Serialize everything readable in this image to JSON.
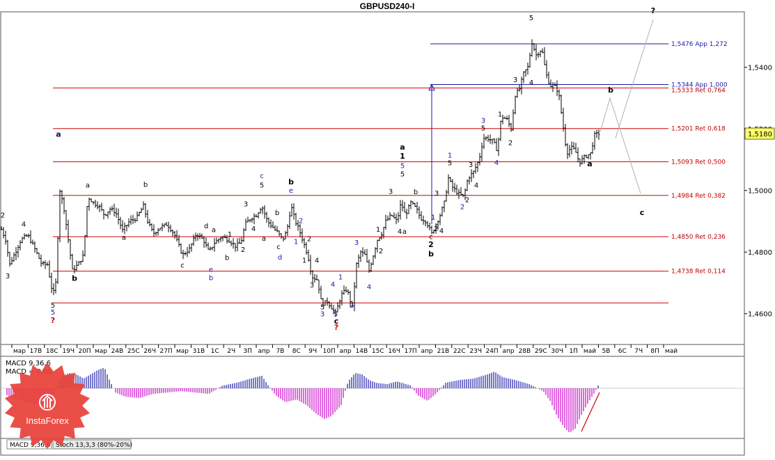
{
  "title": "GBPUSD240-I",
  "current_price": "1,5180",
  "colors": {
    "ret_line": "#d00000",
    "app_line": "#1a1aa8",
    "candle": "#000000",
    "macd_hist": "#cc00cc",
    "macd_hist_pos": "#1a1aa8",
    "projection": "#b0b0b0",
    "logo": "#e8423a"
  },
  "chart_data": {
    "type": "candlestick",
    "symbol": "GBPUSD",
    "timeframe": "H4",
    "ylim": [
      1.45,
      1.558
    ],
    "y_ticks": [
      "1,5400",
      "1,5200",
      "1,5000",
      "1,4800",
      "1,4600"
    ],
    "y_tick_values": [
      1.54,
      1.52,
      1.5,
      1.48,
      1.46
    ],
    "x_ticks": [
      "мар",
      "17В",
      "18С",
      "19Ч",
      "20П",
      "мар",
      "24В",
      "25С",
      "26Ч",
      "27П",
      "мар",
      "31В",
      "1С",
      "2Ч",
      "3П",
      "апр",
      "7В",
      "8С",
      "9Ч",
      "10П",
      "апр",
      "14В",
      "15С",
      "16Ч",
      "17П",
      "апр",
      "21В",
      "22С",
      "23Ч",
      "24П",
      "апр",
      "28В",
      "29С",
      "30Ч",
      "1П",
      "май",
      "5В",
      "6С",
      "7Ч",
      "8П",
      "май"
    ],
    "levels": [
      {
        "label": "1,5476 App 1,272",
        "value": 1.5476,
        "kind": "app"
      },
      {
        "label": "1,5344 App 1,000",
        "value": 1.5344,
        "kind": "app"
      },
      {
        "label": "1,5333 Ret 0,764",
        "value": 1.5333,
        "kind": "ret"
      },
      {
        "label": "1,5201 Ret 0,618",
        "value": 1.5201,
        "kind": "ret"
      },
      {
        "label": "1,5093 Ret 0,500",
        "value": 1.5093,
        "kind": "ret"
      },
      {
        "label": "1,4984 Ret 0,382",
        "value": 1.4984,
        "kind": "ret"
      },
      {
        "label": "1,4850 Ret 0,236",
        "value": 1.485,
        "kind": "ret"
      },
      {
        "label": "1,4738 Ret 0,114",
        "value": 1.4738,
        "kind": "ret"
      },
      {
        "label": "",
        "value": 1.4635,
        "kind": "ret"
      }
    ],
    "path": [
      [
        0,
        1.4885
      ],
      [
        8,
        1.484
      ],
      [
        14,
        1.476
      ],
      [
        22,
        1.48
      ],
      [
        30,
        1.484
      ],
      [
        40,
        1.4855
      ],
      [
        50,
        1.481
      ],
      [
        60,
        1.476
      ],
      [
        68,
        1.476
      ],
      [
        76,
        1.466
      ],
      [
        80,
        1.47
      ],
      [
        86,
        1.5
      ],
      [
        92,
        1.494
      ],
      [
        98,
        1.484
      ],
      [
        104,
        1.474
      ],
      [
        112,
        1.476
      ],
      [
        120,
        1.479
      ],
      [
        126,
        1.498
      ],
      [
        134,
        1.496
      ],
      [
        142,
        1.495
      ],
      [
        150,
        1.492
      ],
      [
        158,
        1.494
      ],
      [
        166,
        1.493
      ],
      [
        176,
        1.487
      ],
      [
        186,
        1.49
      ],
      [
        196,
        1.491
      ],
      [
        206,
        1.495
      ],
      [
        212,
        1.49
      ],
      [
        220,
        1.486
      ],
      [
        230,
        1.488
      ],
      [
        240,
        1.489
      ],
      [
        250,
        1.486
      ],
      [
        262,
        1.479
      ],
      [
        272,
        1.481
      ],
      [
        282,
        1.486
      ],
      [
        292,
        1.484
      ],
      [
        300,
        1.48
      ],
      [
        308,
        1.483
      ],
      [
        318,
        1.485
      ],
      [
        328,
        1.484
      ],
      [
        338,
        1.482
      ],
      [
        346,
        1.483
      ],
      [
        352,
        1.489
      ],
      [
        360,
        1.491
      ],
      [
        368,
        1.492
      ],
      [
        376,
        1.495
      ],
      [
        384,
        1.49
      ],
      [
        392,
        1.488
      ],
      [
        400,
        1.486
      ],
      [
        406,
        1.484
      ],
      [
        412,
        1.487
      ],
      [
        418,
        1.495
      ],
      [
        424,
        1.49
      ],
      [
        430,
        1.487
      ],
      [
        436,
        1.483
      ],
      [
        442,
        1.479
      ],
      [
        448,
        1.472
      ],
      [
        456,
        1.471
      ],
      [
        462,
        1.463
      ],
      [
        470,
        1.464
      ],
      [
        476,
        1.462
      ],
      [
        482,
        1.46
      ],
      [
        490,
        1.466
      ],
      [
        498,
        1.468
      ],
      [
        506,
        1.462
      ],
      [
        512,
        1.476
      ],
      [
        518,
        1.48
      ],
      [
        524,
        1.479
      ],
      [
        530,
        1.474
      ],
      [
        536,
        1.479
      ],
      [
        542,
        1.484
      ],
      [
        548,
        1.486
      ],
      [
        554,
        1.49
      ],
      [
        562,
        1.492
      ],
      [
        570,
        1.49
      ],
      [
        576,
        1.496
      ],
      [
        582,
        1.492
      ],
      [
        590,
        1.496
      ],
      [
        598,
        1.494
      ],
      [
        604,
        1.491
      ],
      [
        612,
        1.49
      ],
      [
        620,
        1.486
      ],
      [
        626,
        1.489
      ],
      [
        632,
        1.492
      ],
      [
        638,
        1.496
      ],
      [
        644,
        1.504
      ],
      [
        650,
        1.501
      ],
      [
        658,
        1.499
      ],
      [
        666,
        1.498
      ],
      [
        672,
        1.504
      ],
      [
        680,
        1.506
      ],
      [
        688,
        1.51
      ],
      [
        694,
        1.517
      ],
      [
        700,
        1.517
      ],
      [
        708,
        1.516
      ],
      [
        714,
        1.513
      ],
      [
        720,
        1.524
      ],
      [
        728,
        1.523
      ],
      [
        734,
        1.52
      ],
      [
        740,
        1.531
      ],
      [
        746,
        1.533
      ],
      [
        752,
        1.538
      ],
      [
        758,
        1.54
      ],
      [
        764,
        1.548
      ],
      [
        770,
        1.544
      ],
      [
        778,
        1.546
      ],
      [
        784,
        1.538
      ],
      [
        790,
        1.534
      ],
      [
        796,
        1.534
      ],
      [
        802,
        1.532
      ],
      [
        808,
        1.522
      ],
      [
        814,
        1.512
      ],
      [
        820,
        1.514
      ],
      [
        826,
        1.513
      ],
      [
        832,
        1.509
      ],
      [
        840,
        1.511
      ],
      [
        848,
        1.512
      ],
      [
        854,
        1.518
      ],
      [
        860,
        1.5185
      ]
    ],
    "wave_labels": [
      {
        "t": "2",
        "x": 4,
        "p": 1.4912,
        "c": "k"
      },
      {
        "t": "4",
        "x": 34,
        "p": 1.4883,
        "c": "k"
      },
      {
        "t": "3",
        "x": 11,
        "p": 1.4715,
        "c": "k"
      },
      {
        "t": "a",
        "x": 84,
        "p": 1.5175,
        "c": "n",
        "b": true
      },
      {
        "t": "5",
        "x": 76,
        "p": 1.462,
        "c": "k"
      },
      {
        "t": "5",
        "x": 76,
        "p": 1.4597,
        "c": "b"
      },
      {
        "t": "?",
        "x": 76,
        "p": 1.457,
        "c": "r",
        "b": true
      },
      {
        "t": "b",
        "x": 107,
        "p": 1.4707,
        "c": "k",
        "b": true
      },
      {
        "t": "a",
        "x": 126,
        "p": 1.5009,
        "c": "k"
      },
      {
        "t": "a",
        "x": 178,
        "p": 1.484,
        "c": "k"
      },
      {
        "t": "b",
        "x": 209,
        "p": 1.5012,
        "c": "k"
      },
      {
        "t": "c",
        "x": 262,
        "p": 1.475,
        "c": "k"
      },
      {
        "t": "d",
        "x": 296,
        "p": 1.4877,
        "c": "k"
      },
      {
        "t": "a",
        "x": 307,
        "p": 1.4865,
        "c": "k"
      },
      {
        "t": "e",
        "x": 303,
        "p": 1.4736,
        "c": "b"
      },
      {
        "t": "b",
        "x": 303,
        "p": 1.4709,
        "c": "b"
      },
      {
        "t": "b",
        "x": 326,
        "p": 1.4775,
        "c": "k"
      },
      {
        "t": "1",
        "x": 330,
        "p": 1.485,
        "c": "k"
      },
      {
        "t": "2",
        "x": 349,
        "p": 1.48,
        "c": "k"
      },
      {
        "t": "3",
        "x": 353,
        "p": 1.4949,
        "c": "k"
      },
      {
        "t": "4",
        "x": 364,
        "p": 1.4868,
        "c": "k"
      },
      {
        "t": "a",
        "x": 379,
        "p": 1.4837,
        "c": "k"
      },
      {
        "t": "c",
        "x": 376,
        "p": 1.504,
        "c": "b"
      },
      {
        "t": "5",
        "x": 376,
        "p": 1.501,
        "c": "k"
      },
      {
        "t": "b",
        "x": 398,
        "p": 1.492,
        "c": "k"
      },
      {
        "t": "c",
        "x": 400,
        "p": 1.481,
        "c": "k"
      },
      {
        "t": "d",
        "x": 402,
        "p": 1.4776,
        "c": "b"
      },
      {
        "t": "b",
        "x": 418,
        "p": 1.502,
        "c": "k",
        "b": true
      },
      {
        "t": "e",
        "x": 418,
        "p": 1.4992,
        "c": "b"
      },
      {
        "t": "2",
        "x": 432,
        "p": 1.4894,
        "c": "b"
      },
      {
        "t": "1",
        "x": 425,
        "p": 1.4826,
        "c": "b"
      },
      {
        "t": "2",
        "x": 444,
        "p": 1.4836,
        "c": "k"
      },
      {
        "t": "1",
        "x": 437,
        "p": 1.4766,
        "c": "k"
      },
      {
        "t": "4",
        "x": 455,
        "p": 1.4766,
        "c": "k"
      },
      {
        "t": "3",
        "x": 448,
        "p": 1.4685,
        "c": "k"
      },
      {
        "t": "5",
        "x": 463,
        "p": 1.4614,
        "c": "k"
      },
      {
        "t": "3",
        "x": 463,
        "p": 1.4592,
        "c": "b"
      },
      {
        "t": "1",
        "x": 489,
        "p": 1.4711,
        "c": "b"
      },
      {
        "t": "4",
        "x": 478,
        "p": 1.4688,
        "c": "b"
      },
      {
        "t": "5",
        "x": 482,
        "p": 1.4592,
        "c": "b"
      },
      {
        "t": "c",
        "x": 483,
        "p": 1.4568,
        "c": "k",
        "b": true
      },
      {
        "t": "?",
        "x": 483,
        "p": 1.4547,
        "c": "r",
        "b": true
      },
      {
        "t": "2",
        "x": 505,
        "p": 1.462,
        "c": "b"
      },
      {
        "t": "3",
        "x": 512,
        "p": 1.4823,
        "c": "b"
      },
      {
        "t": "4",
        "x": 530,
        "p": 1.468,
        "c": "b"
      },
      {
        "t": "2",
        "x": 547,
        "p": 1.4796,
        "c": "k"
      },
      {
        "t": "1",
        "x": 543,
        "p": 1.4866,
        "c": "k"
      },
      {
        "t": "a",
        "x": 578,
        "p": 1.5133,
        "c": "k",
        "b": true
      },
      {
        "t": "1",
        "x": 578,
        "p": 1.5103,
        "c": "k",
        "b": true
      },
      {
        "t": "5",
        "x": 578,
        "p": 1.5073,
        "c": "b"
      },
      {
        "t": "5",
        "x": 578,
        "p": 1.5046,
        "c": "k"
      },
      {
        "t": "3",
        "x": 561,
        "p": 1.4989,
        "c": "k"
      },
      {
        "t": "4",
        "x": 574,
        "p": 1.4859,
        "c": "k"
      },
      {
        "t": "a",
        "x": 581,
        "p": 1.4859,
        "c": "k"
      },
      {
        "t": "b",
        "x": 597,
        "p": 1.4988,
        "c": "k"
      },
      {
        "t": "c",
        "x": 619,
        "p": 1.4842,
        "c": "k"
      },
      {
        "t": "2",
        "x": 619,
        "p": 1.4816,
        "c": "k",
        "b": true
      },
      {
        "t": "b",
        "x": 619,
        "p": 1.4786,
        "c": "k",
        "b": true
      },
      {
        "t": "1",
        "x": 622,
        "p": 1.4906,
        "c": "k"
      },
      {
        "t": "2",
        "x": 626,
        "p": 1.4868,
        "c": "k"
      },
      {
        "t": "3",
        "x": 627,
        "p": 1.4984,
        "c": "k"
      },
      {
        "t": "4",
        "x": 634,
        "p": 1.4862,
        "c": "k"
      },
      {
        "t": "1",
        "x": 646,
        "p": 1.5107,
        "c": "b"
      },
      {
        "t": "5",
        "x": 646,
        "p": 1.5082,
        "c": "k"
      },
      {
        "t": "3",
        "x": 676,
        "p": 1.5076,
        "c": "k"
      },
      {
        "t": "4",
        "x": 684,
        "p": 1.5009,
        "c": "k"
      },
      {
        "t": "2",
        "x": 664,
        "p": 1.494,
        "c": "b"
      },
      {
        "t": "2",
        "x": 671,
        "p": 1.4962,
        "c": "k"
      },
      {
        "t": "3",
        "x": 694,
        "p": 1.522,
        "c": "b"
      },
      {
        "t": "5",
        "x": 694,
        "p": 1.5195,
        "c": "k"
      },
      {
        "t": "4",
        "x": 713,
        "p": 1.5083,
        "c": "b"
      },
      {
        "t": "1",
        "x": 718,
        "p": 1.524,
        "c": "k"
      },
      {
        "t": "2",
        "x": 733,
        "p": 1.5147,
        "c": "k"
      },
      {
        "t": "3",
        "x": 740,
        "p": 1.5352,
        "c": "k"
      },
      {
        "t": "4",
        "x": 763,
        "p": 1.5343,
        "c": "k"
      },
      {
        "t": "5",
        "x": 762,
        "p": 1.5633,
        "c": "b"
      },
      {
        "t": "3",
        "x": 779,
        "p": 1.5633,
        "c": "k",
        "b": true
      },
      {
        "t": "c",
        "x": 790,
        "p": 1.5633,
        "c": "k",
        "b": true
      },
      {
        "t": "?",
        "x": 805,
        "p": 1.5633,
        "c": "k",
        "b": true
      },
      {
        "t": "5",
        "x": 763,
        "p": 1.5553,
        "c": "k"
      },
      {
        "t": "a",
        "x": 847,
        "p": 1.5078,
        "c": "k",
        "b": true
      },
      {
        "t": "b",
        "x": 877,
        "p": 1.5318,
        "c": "k",
        "b": true
      },
      {
        "t": "?",
        "x": 938,
        "p": 1.5575,
        "c": "k",
        "b": true
      },
      {
        "t": "c",
        "x": 922,
        "p": 1.492,
        "c": "k",
        "b": true
      }
    ],
    "projection": [
      [
        862,
        1.519
      ],
      [
        876,
        1.53
      ],
      [
        920,
        1.499
      ]
    ],
    "projection_alt": [
      [
        884,
        1.517
      ],
      [
        938,
        1.5555
      ]
    ],
    "app_arrow": {
      "x": 620,
      "from": 1.489,
      "to": 1.5344
    }
  },
  "indicator": {
    "label_1": "MACD 9,36,6",
    "label_2": "MACD = 0,00",
    "tab_1": "MACD 9,36,6",
    "tab_2": "Stoch 13,3,3 (80%-20%)",
    "histogram": [
      [
        10,
        -10
      ],
      [
        30,
        -18
      ],
      [
        50,
        -22
      ],
      [
        70,
        -20
      ],
      [
        80,
        0
      ],
      [
        90,
        18
      ],
      [
        100,
        22
      ],
      [
        110,
        20
      ],
      [
        120,
        14
      ],
      [
        130,
        20
      ],
      [
        140,
        26
      ],
      [
        150,
        30
      ],
      [
        158,
        10
      ],
      [
        166,
        -6
      ],
      [
        180,
        -12
      ],
      [
        200,
        -14
      ],
      [
        220,
        -8
      ],
      [
        240,
        -6
      ],
      [
        260,
        -4
      ],
      [
        280,
        -6
      ],
      [
        300,
        -8
      ],
      [
        320,
        4
      ],
      [
        340,
        8
      ],
      [
        360,
        14
      ],
      [
        376,
        18
      ],
      [
        384,
        6
      ],
      [
        396,
        -10
      ],
      [
        410,
        -20
      ],
      [
        426,
        -16
      ],
      [
        440,
        -24
      ],
      [
        456,
        -38
      ],
      [
        466,
        -44
      ],
      [
        476,
        -40
      ],
      [
        490,
        -24
      ],
      [
        500,
        10
      ],
      [
        510,
        22
      ],
      [
        520,
        20
      ],
      [
        530,
        12
      ],
      [
        540,
        8
      ],
      [
        556,
        6
      ],
      [
        570,
        10
      ],
      [
        590,
        4
      ],
      [
        600,
        -10
      ],
      [
        614,
        -18
      ],
      [
        626,
        -8
      ],
      [
        640,
        8
      ],
      [
        660,
        12
      ],
      [
        680,
        14
      ],
      [
        700,
        20
      ],
      [
        710,
        24
      ],
      [
        722,
        16
      ],
      [
        740,
        12
      ],
      [
        760,
        6
      ],
      [
        780,
        -4
      ],
      [
        790,
        -18
      ],
      [
        800,
        -40
      ],
      [
        810,
        -56
      ],
      [
        818,
        -64
      ],
      [
        826,
        -58
      ],
      [
        834,
        -40
      ],
      [
        844,
        -22
      ],
      [
        854,
        -6
      ],
      [
        860,
        6
      ]
    ]
  },
  "logo": {
    "text": "InstaForex"
  }
}
